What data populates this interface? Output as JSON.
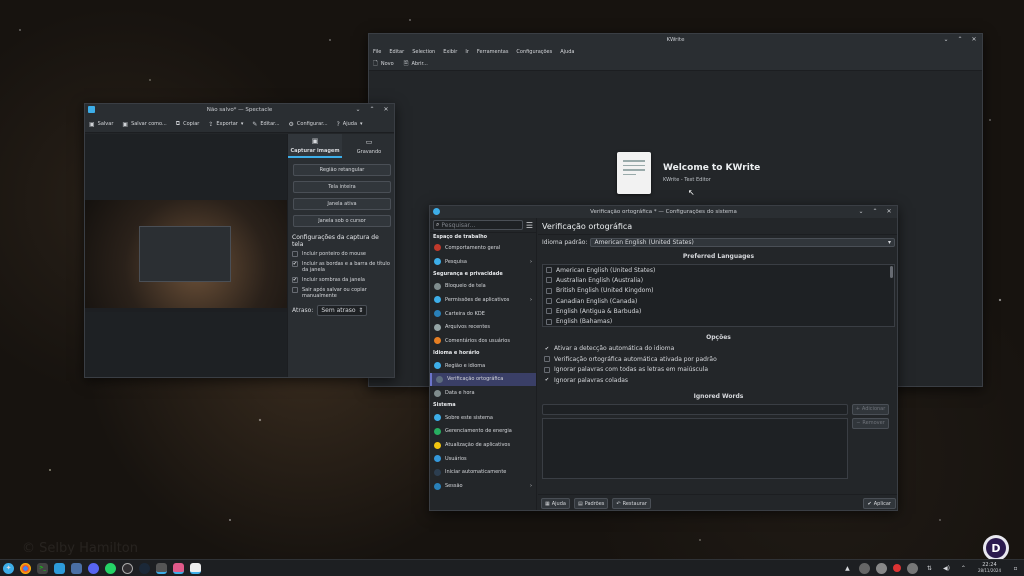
{
  "kwrite": {
    "title": "KWrite",
    "menu": [
      "File",
      "Editar",
      "Selection",
      "Exibir",
      "Ir",
      "Ferramentas",
      "Configurações",
      "Ajuda"
    ],
    "toolbar": {
      "new_label": "Novo",
      "open_label": "Abrir..."
    },
    "welcome_title": "Welcome to KWrite",
    "welcome_sub": "KWrite - Text Editor"
  },
  "spectacle": {
    "title": "Não salvo* — Spectacle",
    "toolbar": {
      "save": "Salvar",
      "save_as": "Salvar como...",
      "copy": "Copiar",
      "export": "Exportar",
      "edit": "Editar...",
      "configure": "Configurar...",
      "help": "Ajuda"
    },
    "tabs": {
      "capture": "Capturar imagem",
      "record": "Gravando"
    },
    "capture_buttons": [
      "Região retangular",
      "Tela inteira",
      "Janela ativa",
      "Janela sob o cursor"
    ],
    "settings_title": "Configurações da captura de tela",
    "options": [
      {
        "label": "Incluir ponteiro do mouse",
        "checked": false
      },
      {
        "label": "Incluir as bordas e a barra de título da janela",
        "checked": true
      },
      {
        "label": "Incluir sombras da janela",
        "checked": true
      },
      {
        "label": "Sair após salvar ou copiar manualmente",
        "checked": false
      }
    ],
    "delay_label": "Atraso:",
    "delay_value": "Sem atraso"
  },
  "settings": {
    "title": "Verificação ortográfica * — Configurações do sistema",
    "search_placeholder": "Pesquisar...",
    "sidebar": {
      "top_partial": "Espaço de trabalho",
      "items_a": [
        {
          "label": "Comportamento geral",
          "color": "#c0392b"
        },
        {
          "label": "Pesquisa",
          "color": "#3daee9",
          "arrow": true
        }
      ],
      "hdr_security": "Segurança e privacidade",
      "items_b": [
        {
          "label": "Bloqueio de tela",
          "color": "#7f8c8d"
        },
        {
          "label": "Permissões de aplicativos",
          "color": "#3daee9",
          "arrow": true
        },
        {
          "label": "Carteira do KDE",
          "color": "#2980b9"
        },
        {
          "label": "Arquivos recentes",
          "color": "#95a5a6"
        },
        {
          "label": "Comentários dos usuários",
          "color": "#e67e22"
        }
      ],
      "hdr_lang": "Idioma e horário",
      "items_c": [
        {
          "label": "Região e idioma",
          "color": "#3daee9"
        },
        {
          "label": "Verificação ortográfica",
          "color": "#5d6d7e",
          "selected": true
        },
        {
          "label": "Data e hora",
          "color": "#7f8c8d"
        }
      ],
      "hdr_system": "Sistema",
      "items_d": [
        {
          "label": "Sobre este sistema",
          "color": "#3daee9"
        },
        {
          "label": "Gerenciamento de energia",
          "color": "#27ae60"
        },
        {
          "label": "Atualização de aplicativos",
          "color": "#f1c40f"
        },
        {
          "label": "Usuários",
          "color": "#3498db"
        },
        {
          "label": "Iniciar automaticamente",
          "color": "#2c3e50"
        },
        {
          "label": "Sessão",
          "color": "#2980b9",
          "arrow": true
        }
      ]
    },
    "page_title": "Verificação ortográfica",
    "default_lang_label": "Idioma padrão:",
    "default_lang_value": "American English (United States)",
    "preferred_title": "Preferred Languages",
    "languages": [
      "American English (United States)",
      "Australian English (Australia)",
      "British English (United Kingdom)",
      "Canadian English (Canada)",
      "English (Antigua & Barbuda)",
      "English (Bahamas)"
    ],
    "options_title": "Opções",
    "options": [
      {
        "label": "Ativar a detecção automática do idioma",
        "checked": true
      },
      {
        "label": "Verificação ortográfica automática ativada por padrão",
        "checked": false
      },
      {
        "label": "Ignorar palavras com todas as letras em maiúscula",
        "checked": false
      },
      {
        "label": "Ignorar palavras coladas",
        "checked": true
      }
    ],
    "ignored_title": "Ignored Words",
    "add_label": "Adicionar",
    "remove_label": "Remover",
    "footer": {
      "help": "Ajuda",
      "defaults": "Padrões",
      "reset": "Restaurar",
      "apply": "Aplicar"
    }
  },
  "taskbar": {
    "time": "22:24",
    "date": "28/11/2024"
  },
  "watermark": "© Selby Hamilton"
}
